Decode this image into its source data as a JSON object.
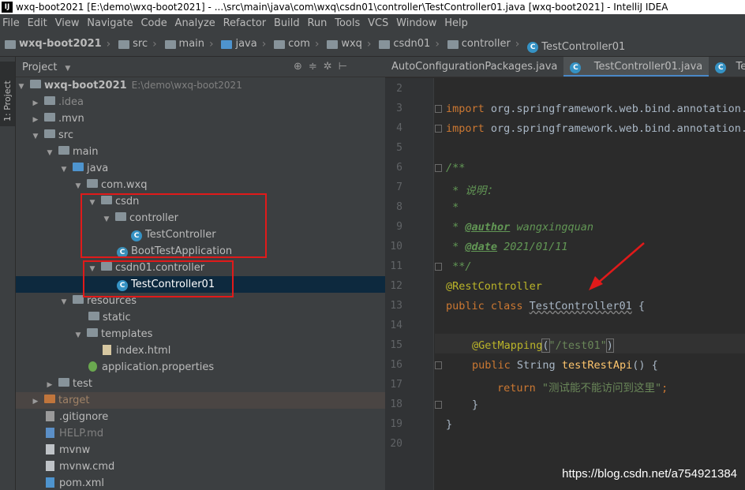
{
  "window": {
    "title": "wxq-boot2021 [E:\\demo\\wxq-boot2021] - ...\\src\\main\\java\\com\\wxq\\csdn01\\controller\\TestController01.java [wxq-boot2021] - IntelliJ IDEA",
    "app_icon_label": "IJ"
  },
  "menu": [
    "File",
    "Edit",
    "View",
    "Navigate",
    "Code",
    "Analyze",
    "Refactor",
    "Build",
    "Run",
    "Tools",
    "VCS",
    "Window",
    "Help"
  ],
  "breadcrumbs": [
    "wxq-boot2021",
    "src",
    "main",
    "java",
    "com",
    "wxq",
    "csdn01",
    "controller",
    "TestController01"
  ],
  "side_tab": "1: Project",
  "project_panel": {
    "title": "Project",
    "tree": [
      {
        "label": "wxq-boot2021",
        "path": "E:\\demo\\wxq-boot2021"
      },
      {
        "label": ".idea"
      },
      {
        "label": ".mvn"
      },
      {
        "label": "src"
      },
      {
        "label": "main"
      },
      {
        "label": "java"
      },
      {
        "label": "com.wxq"
      },
      {
        "label": "csdn"
      },
      {
        "label": "controller"
      },
      {
        "label": "TestController"
      },
      {
        "label": "BootTestApplication"
      },
      {
        "label": "csdn01.controller"
      },
      {
        "label": "TestController01"
      },
      {
        "label": "resources"
      },
      {
        "label": "static"
      },
      {
        "label": "templates"
      },
      {
        "label": "index.html"
      },
      {
        "label": "application.properties"
      },
      {
        "label": "test"
      },
      {
        "label": "target"
      },
      {
        "label": ".gitignore"
      },
      {
        "label": "HELP.md"
      },
      {
        "label": "mvnw"
      },
      {
        "label": "mvnw.cmd"
      },
      {
        "label": "pom.xml"
      }
    ]
  },
  "editor": {
    "tabs": [
      "AutoConfigurationPackages.java",
      "TestController01.java",
      "Test"
    ],
    "line_numbers": [
      "2",
      "3",
      "4",
      "5",
      "6",
      "7",
      "8",
      "9",
      "10",
      "11",
      "12",
      "13",
      "14",
      "15",
      "16",
      "17",
      "18",
      "19",
      "20"
    ],
    "code": {
      "import_kw": "import",
      "import1": "org.springframework.web.bind.annotation.G",
      "import2": "org.springframework.web.bind.annotation.R",
      "doc_open": "/**",
      "doc_desc": " * 说明：",
      "doc_star": " *",
      "doc_author_tag": "@author",
      "doc_author": " wangxingquan",
      "doc_date_tag": "@date",
      "doc_date": " 2021/01/11",
      "doc_close": " **/",
      "rest_ann": "@RestController",
      "public_class": "public class ",
      "class_name": "TestController01",
      "brace_open": " {",
      "get_ann": "@GetMapping",
      "get_arg": "\"/test01\"",
      "public": "public",
      "string_type": " String ",
      "method": "testRestApi",
      "method_tail": "() {",
      "return_kw": "return",
      "return_str": " \"测试能不能访问到这里\"",
      "semi": ";",
      "close_inner": "}",
      "close_outer": "}"
    }
  },
  "watermark": "https://blog.csdn.net/a754921384",
  "colors": {
    "highlight_box": "#e01a1a",
    "arrow": "#e01a1a",
    "active_tab_underline": "#4a88c7"
  }
}
